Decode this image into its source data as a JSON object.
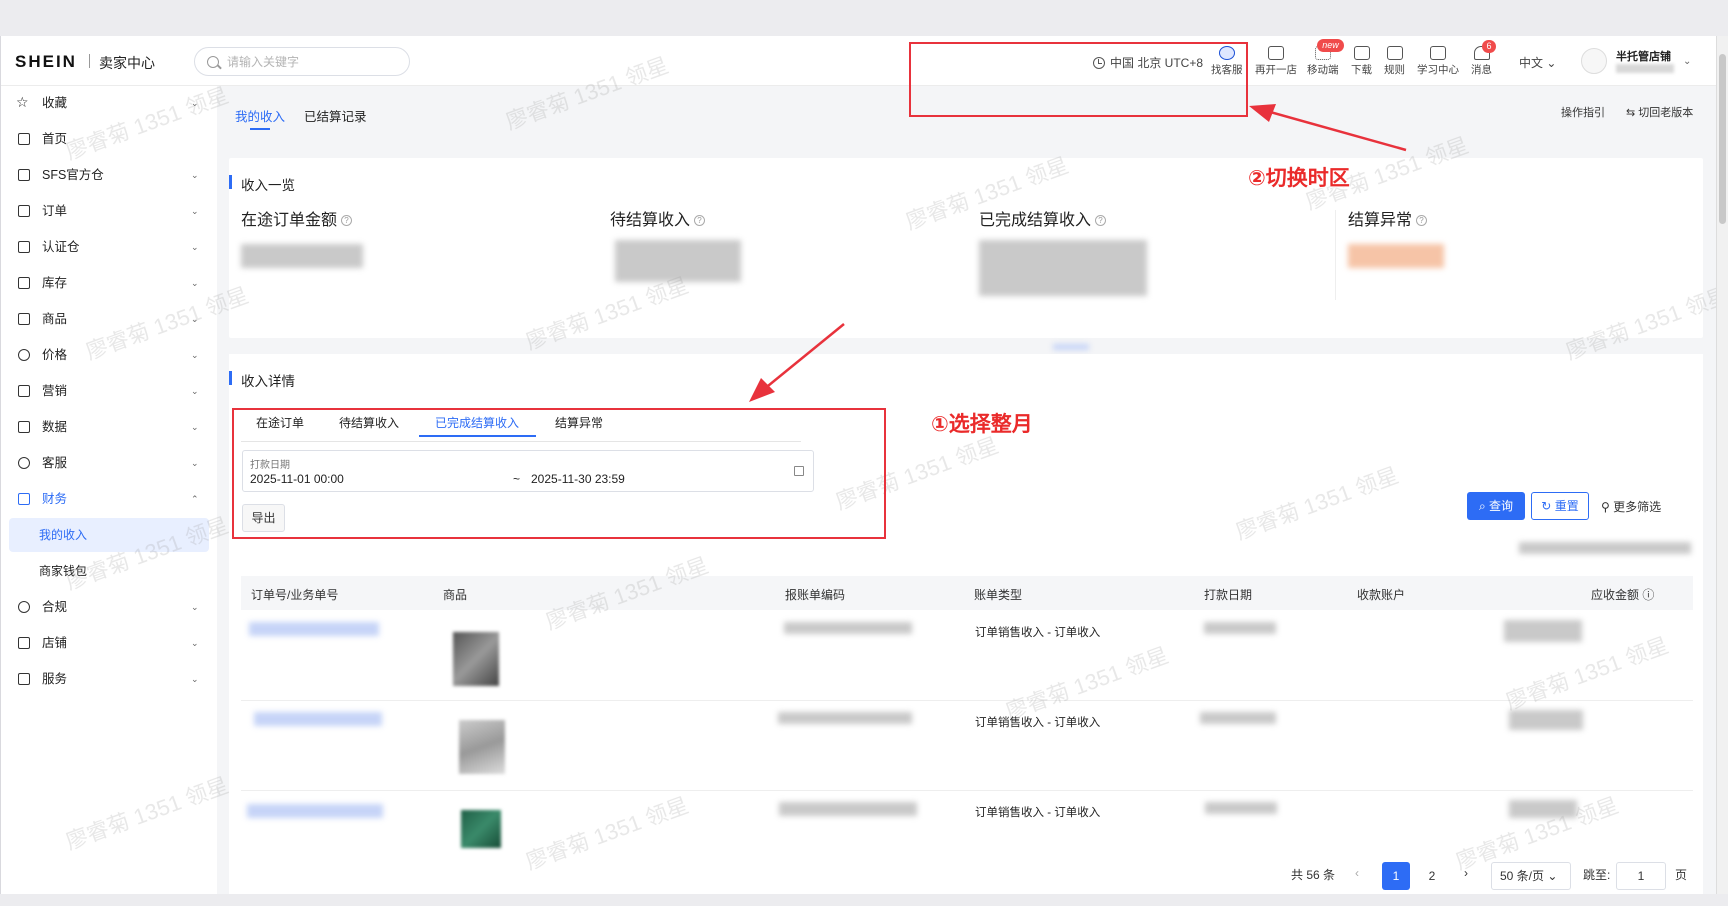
{
  "header": {
    "brand": "SHEIN",
    "portal": "卖家中心",
    "search_placeholder": "请输入关键字",
    "timezone": "中国 北京 UTC+8",
    "icons": [
      {
        "label": "找客服",
        "icon": "customer-service-icon"
      },
      {
        "label": "再开一店",
        "icon": "store-icon"
      },
      {
        "label": "移动端",
        "icon": "mobile-app-icon",
        "badge": "new"
      },
      {
        "label": "下载",
        "icon": "download-icon"
      },
      {
        "label": "规则",
        "icon": "rules-icon"
      },
      {
        "label": "学习中心",
        "icon": "learning-center-icon"
      },
      {
        "label": "消息",
        "icon": "bell-icon",
        "badge": "6"
      }
    ],
    "language": "中文",
    "shop_name": "半托管店铺"
  },
  "sidebar": {
    "items": [
      {
        "label": "收藏",
        "icon": "star-icon",
        "chevron": "down"
      },
      {
        "label": "首页",
        "icon": "monitor-icon"
      },
      {
        "label": "SFS官方仓",
        "icon": "warehouse-icon",
        "chevron": "down"
      },
      {
        "label": "订单",
        "icon": "printer-icon",
        "chevron": "down"
      },
      {
        "label": "认证仓",
        "icon": "certified-warehouse-icon",
        "chevron": "down"
      },
      {
        "label": "库存",
        "icon": "inventory-icon",
        "chevron": "down"
      },
      {
        "label": "商品",
        "icon": "product-icon",
        "chevron": "down"
      },
      {
        "label": "价格",
        "icon": "price-icon",
        "chevron": "down"
      },
      {
        "label": "营销",
        "icon": "marketing-icon",
        "chevron": "down"
      },
      {
        "label": "数据",
        "icon": "data-icon",
        "chevron": "down"
      },
      {
        "label": "客服",
        "icon": "headset-icon",
        "chevron": "down"
      },
      {
        "label": "财务",
        "icon": "wallet-icon",
        "chevron": "up",
        "open": true,
        "children": [
          "我的收入",
          "商家钱包"
        ]
      },
      {
        "label": "合规",
        "icon": "shield-icon",
        "chevron": "down"
      },
      {
        "label": "店铺",
        "icon": "shop-icon",
        "chevron": "down"
      },
      {
        "label": "服务",
        "icon": "service-icon",
        "chevron": "down"
      }
    ]
  },
  "page_tabs": [
    "我的收入",
    "已结算记录"
  ],
  "top_links": {
    "guide": "操作指引",
    "old_version": "⇆ 切回老版本"
  },
  "overview": {
    "title": "收入一览",
    "stats": [
      "在途订单金额",
      "待结算收入",
      "已完成结算收入",
      "结算异常"
    ]
  },
  "detail": {
    "title": "收入详情",
    "tabs": [
      "在途订单",
      "待结算收入",
      "已完成结算收入",
      "结算异常"
    ],
    "active_tab": 2,
    "date_label": "打款日期",
    "date_start": "2025-11-01 00:00",
    "date_sep": "~",
    "date_end": "2025-11-30 23:59",
    "export_label": "导出",
    "query_label": "查询",
    "reset_label": "重置",
    "more_filters_label": "更多筛选",
    "columns": [
      "订单号/业务单号",
      "商品",
      "报账单编码",
      "账单类型",
      "打款日期",
      "收款账户",
      "应收金额"
    ],
    "rows": [
      {
        "bill_type": "订单销售收入 - 订单收入"
      },
      {
        "bill_type": "订单销售收入 - 订单收入"
      },
      {
        "bill_type": "订单销售收入 - 订单收入"
      }
    ]
  },
  "pagination": {
    "total": "共 56 条",
    "pages": [
      "1",
      "2"
    ],
    "current": "1",
    "page_size": "50 条/页",
    "jump_label": "跳至:",
    "jump_value": "1",
    "page_unit": "页"
  },
  "annotations": {
    "step1": "①选择整月",
    "step2": "②切换时区"
  },
  "colors": {
    "accent": "#2d6cf5",
    "annotation": "#e8323c",
    "badge": "#f04b4b"
  }
}
